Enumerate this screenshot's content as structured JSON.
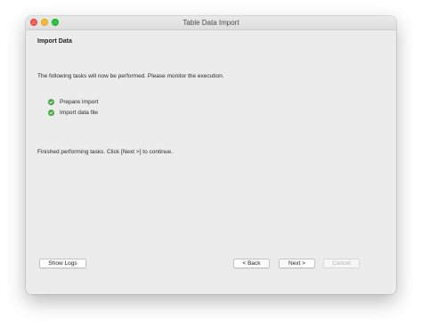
{
  "window": {
    "title": "Table Data Import"
  },
  "page": {
    "heading": "Import Data",
    "intro": "The following tasks will now be performed. Please monitor the execution.",
    "tasks": [
      {
        "label": "Prepare Import",
        "status": "done",
        "icon": "check-circle-icon"
      },
      {
        "label": "Import data file",
        "status": "done",
        "icon": "check-circle-icon"
      }
    ],
    "status_text": "Finished performing tasks. Click [Next >] to continue."
  },
  "buttons": {
    "show_logs": "Show Logs",
    "back": "< Back",
    "next": "Next >",
    "cancel": "Cancel"
  },
  "colors": {
    "success": "#3daa3f",
    "close": "#fe5f57",
    "minimize": "#febc2e",
    "maximize": "#28c840"
  }
}
